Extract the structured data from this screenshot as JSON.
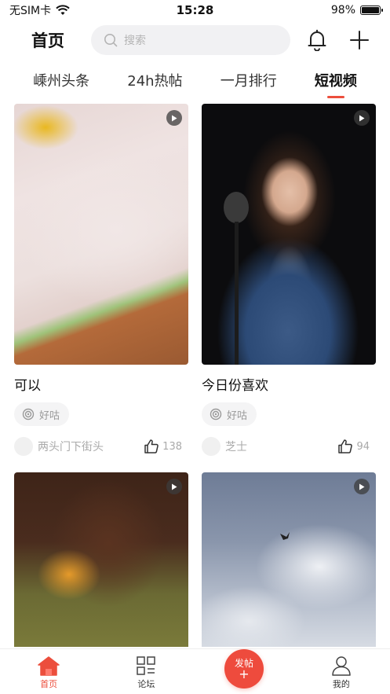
{
  "status_bar": {
    "carrier": "无SIM卡",
    "time": "15:28",
    "battery_percent": "98%",
    "battery_level": 0.98
  },
  "header": {
    "title": "首页",
    "search_placeholder": "搜索",
    "icons": [
      "bell-icon",
      "plus-icon",
      "search-icon"
    ]
  },
  "tabs": [
    {
      "label": "嵊州头条",
      "active": false
    },
    {
      "label": "24h热帖",
      "active": false
    },
    {
      "label": "一月排行",
      "active": false
    },
    {
      "label": "短视频",
      "active": true
    }
  ],
  "accent_color": "#ec4e3c",
  "posts": [
    {
      "title": "可以",
      "tag": "好咕",
      "author": "两头门下街头",
      "likes": "138"
    },
    {
      "title": "今日份喜欢",
      "tag": "好咕",
      "author": "芝士",
      "likes": "94"
    },
    {
      "title": "",
      "tag": "",
      "author": "",
      "likes": ""
    },
    {
      "title": "",
      "tag": "",
      "author": "",
      "likes": ""
    }
  ],
  "bottom_nav": {
    "home": "首页",
    "forum": "论坛",
    "post": "发帖",
    "post_plus": "+",
    "mine": "我的"
  }
}
